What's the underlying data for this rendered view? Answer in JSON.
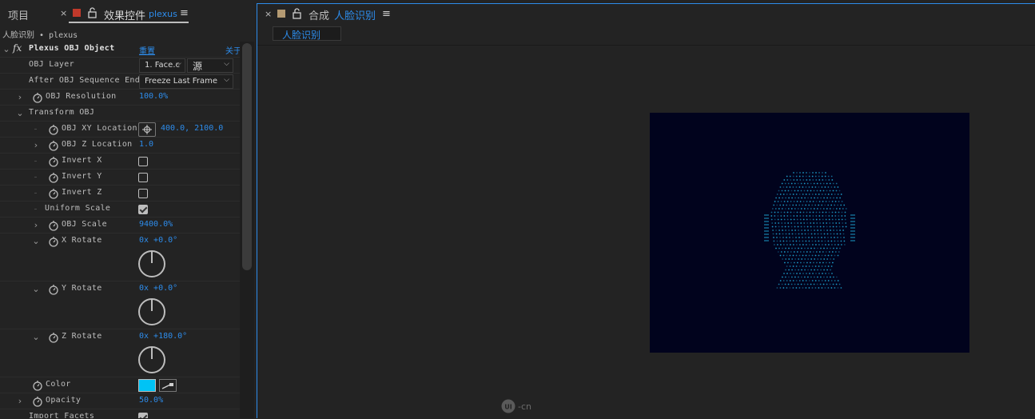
{
  "left_panel": {
    "project_tab": "项目",
    "effects_tab_label": "效果控件",
    "effects_tab_layer": "plexus",
    "breadcrumb": "人脸识别 • plexus",
    "effect_name": "Plexus OBJ Object",
    "reset_label": "重置",
    "about_label": "关于",
    "rows": {
      "obj_layer": {
        "label": "OBJ Layer",
        "value": "1. Face.c",
        "source": "源"
      },
      "after_seq_end": {
        "label": "After OBJ Sequence End",
        "value": "Freeze Last Frame"
      },
      "resolution": {
        "label": "OBJ Resolution",
        "value": "100.0%"
      },
      "transform": {
        "label": "Transform OBJ"
      },
      "xy_location": {
        "label": "OBJ XY Location",
        "value": "400.0, 2100.0"
      },
      "z_location": {
        "label": "OBJ Z Location",
        "value": "1.0"
      },
      "invert_x": {
        "label": "Invert X",
        "checked": false
      },
      "invert_y": {
        "label": "Invert Y",
        "checked": false
      },
      "invert_z": {
        "label": "Invert Z",
        "checked": false
      },
      "uniform_scale": {
        "label": "Uniform Scale",
        "checked": true
      },
      "obj_scale": {
        "label": "OBJ Scale",
        "value": "9400.0%"
      },
      "x_rotate": {
        "label": "X Rotate",
        "value": "0x +0.0°"
      },
      "y_rotate": {
        "label": "Y Rotate",
        "value": "0x +0.0°"
      },
      "z_rotate": {
        "label": "Z Rotate",
        "value": "0x +180.0°"
      },
      "color": {
        "label": "Color",
        "value": "#00c3f5"
      },
      "opacity": {
        "label": "Opacity",
        "value": "50.0%"
      },
      "import_facets": {
        "label": "Import Facets",
        "checked": true
      }
    }
  },
  "right_panel": {
    "tab_prefix": "合成",
    "comp_name": "人脸识别",
    "comp_tab": "人脸识别"
  },
  "watermark": "-cn",
  "colors": {
    "accent": "#2d8ceb",
    "canvas_bg": "#01031d",
    "wire": "#1fa7d6",
    "label_red": "#c0392b",
    "label_tan": "#b49a72"
  }
}
